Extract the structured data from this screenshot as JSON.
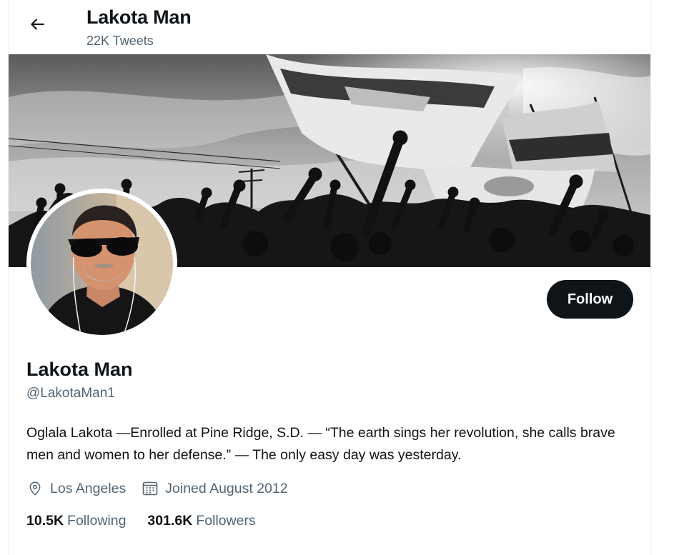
{
  "header": {
    "title": "Lakota Man",
    "tweet_count": "22K Tweets"
  },
  "icons": {
    "back": "arrow-left-icon",
    "location": "map-pin-icon",
    "joined": "calendar-icon"
  },
  "profile": {
    "display_name": "Lakota Man",
    "handle": "@LakotaMan1",
    "bio": "Oglala Lakota —Enrolled at Pine Ridge, S.D. — “The earth sings her revolution, she calls brave men and women to her defense.” — The only easy day was yesterday.",
    "location": "Los Angeles",
    "joined": "Joined August 2012",
    "follow_label": "Follow",
    "following_count": "10.5K",
    "following_label": "Following",
    "followers_count": "301.6K",
    "followers_label": "Followers"
  },
  "colors": {
    "text_primary": "#0f1419",
    "text_secondary": "#536471",
    "follow_bg": "#0f1419"
  }
}
